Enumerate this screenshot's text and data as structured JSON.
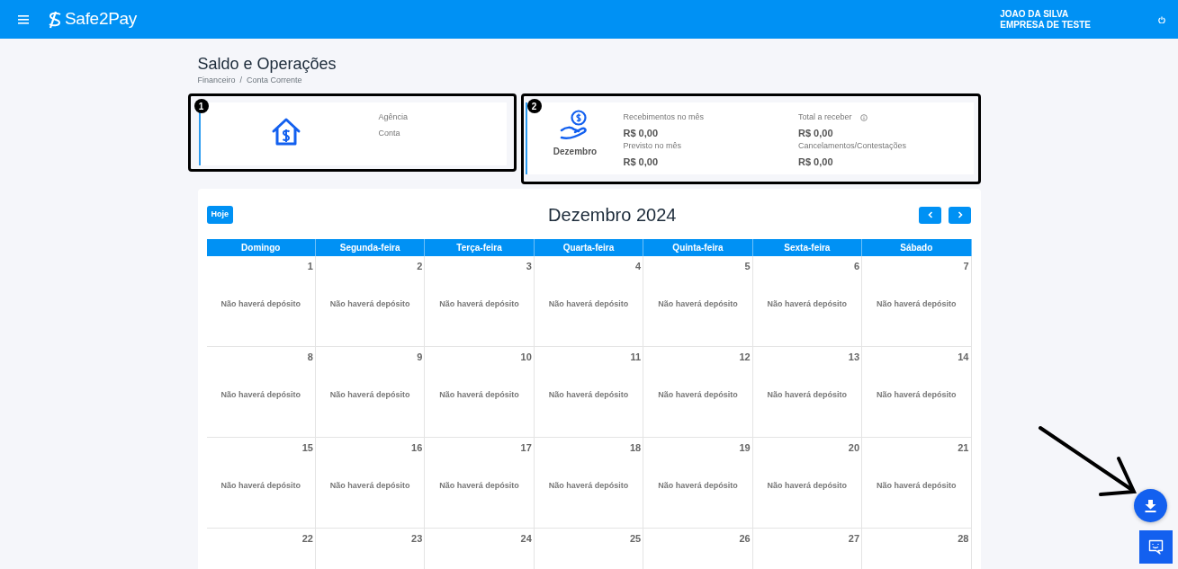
{
  "navbar": {
    "brand": "Safe2Pay",
    "user_name": "JOAO DA SILVA",
    "company": "EMPRESA DE TESTE"
  },
  "page": {
    "title": "Saldo e Operações",
    "breadcrumb": "Financeiro  /  Conta Corrente"
  },
  "account_card": {
    "badge": "1",
    "fields": [
      "Agência",
      "Conta"
    ]
  },
  "summary_card": {
    "badge": "2",
    "month": "Dezembro",
    "columns": [
      [
        {
          "label": "Recebimentos no mês",
          "value": "R$ 0,00",
          "info": false
        },
        {
          "label": "Previsto no mês",
          "value": "R$ 0,00",
          "info": false
        }
      ],
      [
        {
          "label": "Total a receber",
          "value": "R$ 0,00",
          "info": true
        },
        {
          "label": "Cancelamentos/Contestações",
          "value": "R$ 0,00",
          "info": false
        }
      ]
    ]
  },
  "calendar": {
    "today_button": "Hoje",
    "title": "Dezembro 2024",
    "weekdays": [
      "Domingo",
      "Segunda-feira",
      "Terça-feira",
      "Quarta-feira",
      "Quinta-feira",
      "Sexta-feira",
      "Sábado"
    ],
    "weeks": [
      [
        {
          "day": "1",
          "note": "Não haverá depósito"
        },
        {
          "day": "2",
          "note": "Não haverá depósito"
        },
        {
          "day": "3",
          "note": "Não haverá depósito"
        },
        {
          "day": "4",
          "note": "Não haverá depósito"
        },
        {
          "day": "5",
          "note": "Não haverá depósito"
        },
        {
          "day": "6",
          "note": "Não haverá depósito"
        },
        {
          "day": "7",
          "note": "Não haverá depósito"
        }
      ],
      [
        {
          "day": "8",
          "note": "Não haverá depósito"
        },
        {
          "day": "9",
          "note": "Não haverá depósito"
        },
        {
          "day": "10",
          "note": "Não haverá depósito"
        },
        {
          "day": "11",
          "note": "Não haverá depósito"
        },
        {
          "day": "12",
          "note": "Não haverá depósito"
        },
        {
          "day": "13",
          "note": "Não haverá depósito"
        },
        {
          "day": "14",
          "note": "Não haverá depósito"
        }
      ],
      [
        {
          "day": "15",
          "note": "Não haverá depósito"
        },
        {
          "day": "16",
          "note": "Não haverá depósito"
        },
        {
          "day": "17",
          "note": "Não haverá depósito"
        },
        {
          "day": "18",
          "note": "Não haverá depósito"
        },
        {
          "day": "19",
          "note": "Não haverá depósito"
        },
        {
          "day": "20",
          "note": "Não haverá depósito"
        },
        {
          "day": "21",
          "note": "Não haverá depósito"
        }
      ],
      [
        {
          "day": "22"
        },
        {
          "day": "23"
        },
        {
          "day": "24"
        },
        {
          "day": "25"
        },
        {
          "day": "26"
        },
        {
          "day": "27"
        },
        {
          "day": "28"
        }
      ]
    ]
  }
}
